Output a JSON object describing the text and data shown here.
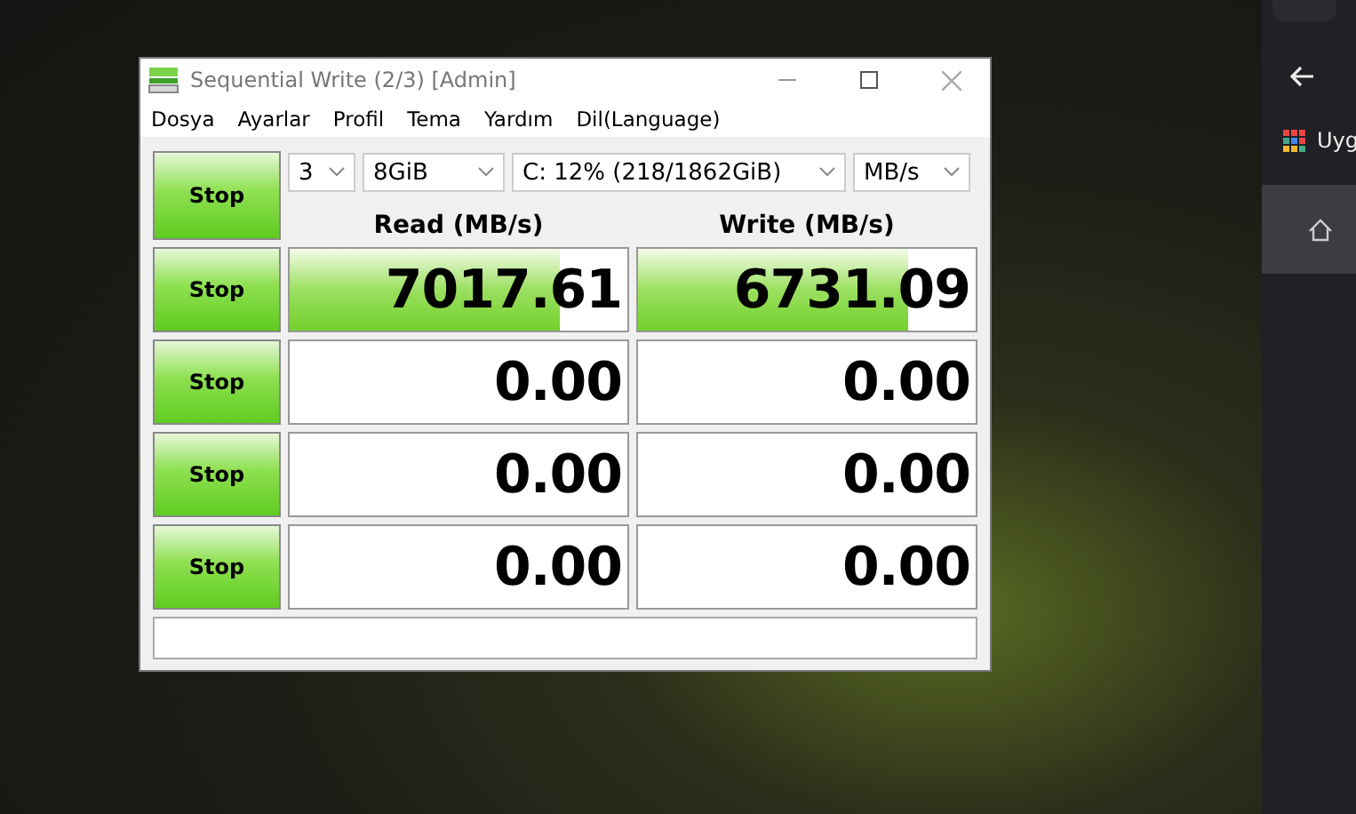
{
  "window": {
    "title": "Sequential Write (2/3) [Admin]"
  },
  "menu": [
    "Dosya",
    "Ayarlar",
    "Profil",
    "Tema",
    "Yardım",
    "Dil(Language)"
  ],
  "settings": {
    "count": "3",
    "size": "8GiB",
    "drive": "C: 12% (218/1862GiB)",
    "unit": "MB/s"
  },
  "columns": [
    "Read (MB/s)",
    "Write (MB/s)"
  ],
  "rows": [
    {
      "button": "Stop",
      "read": {
        "value": "7017.61",
        "level": 0.8
      },
      "write": {
        "value": "6731.09",
        "level": 0.8
      }
    },
    {
      "button": "Stop",
      "read": {
        "value": "0.00"
      },
      "write": {
        "value": "0.00"
      }
    },
    {
      "button": "Stop",
      "read": {
        "value": "0.00"
      },
      "write": {
        "value": "0.00"
      }
    },
    {
      "button": "Stop",
      "read": {
        "value": "0.00"
      },
      "write": {
        "value": "0.00"
      }
    }
  ],
  "all_button": "Stop",
  "browser": {
    "bookmark": "Uyg"
  }
}
